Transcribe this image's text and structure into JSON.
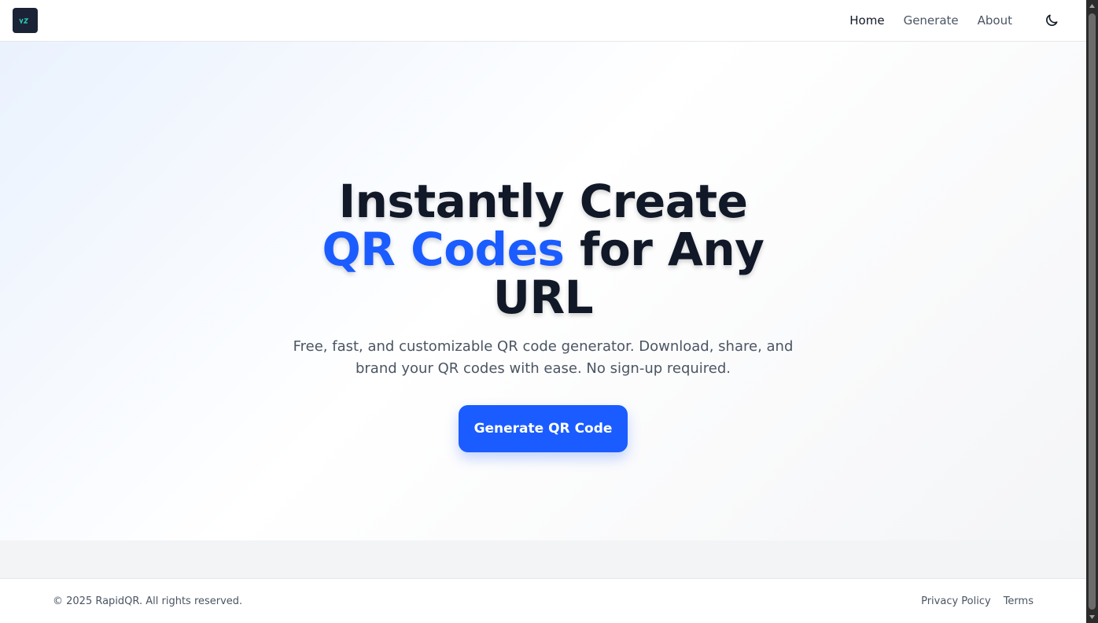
{
  "header": {
    "logo_icon": "vz-logo-icon",
    "nav": [
      {
        "label": "Home",
        "active": true
      },
      {
        "label": "Generate",
        "active": false
      },
      {
        "label": "About",
        "active": false
      }
    ],
    "theme_icon": "moon-icon"
  },
  "hero": {
    "title_part1": "Instantly Create ",
    "title_accent": "QR Codes",
    "title_part2": " for Any URL",
    "subtitle": "Free, fast, and customizable QR code generator. Download, share, and brand your QR codes with ease. No sign-up required.",
    "cta_label": "Generate QR Code"
  },
  "footer": {
    "copyright": "© 2025 RapidQR. All rights reserved.",
    "links": [
      "Privacy Policy",
      "Terms"
    ]
  },
  "colors": {
    "accent": "#1a5cff",
    "text_dark": "#111827",
    "text_muted": "#4b5563"
  }
}
